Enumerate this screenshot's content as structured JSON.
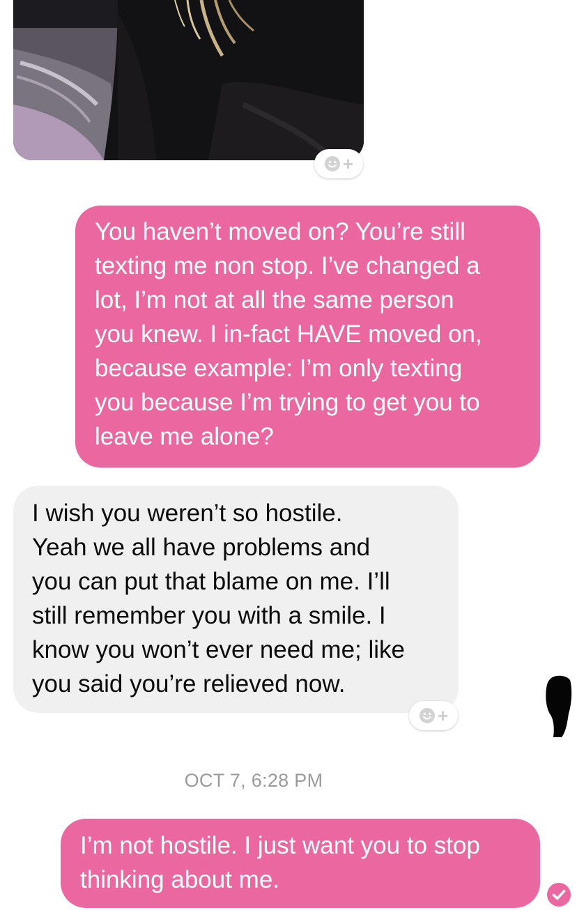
{
  "messages": [
    {
      "direction": "incoming",
      "type": "photo",
      "reaction_add": "+"
    },
    {
      "direction": "outgoing",
      "type": "text",
      "text": "You haven’t moved on? You’re still\ntexting me non stop. I’ve changed a\nlot, I’m not at all the same person\nyou knew. I in-fact HAVE moved on,\nbecause example: I’m only texting\nyou because I’m trying to get you to\nleave me alone?"
    },
    {
      "direction": "incoming",
      "type": "text",
      "text": "I wish you weren’t so hostile.\nYeah we all have problems and\nyou can put that blame on me.  I’ll\nstill remember you with a smile.  I\nknow you won’t ever need me; like\nyou said you’re relieved now.",
      "reaction_add": "+"
    },
    {
      "direction": "outgoing",
      "type": "text",
      "text": "I’m not hostile. I just want you to stop\nthinking about me."
    }
  ],
  "timestamp": "OCT 7, 6:28 PM",
  "colors": {
    "outgoing_bubble": "#ea679f",
    "incoming_bubble": "#f0f0f0",
    "seen_indicator": "#ea679f"
  },
  "icons": {
    "reaction": "smiley-plus-icon",
    "seen": "check-circle-icon"
  }
}
